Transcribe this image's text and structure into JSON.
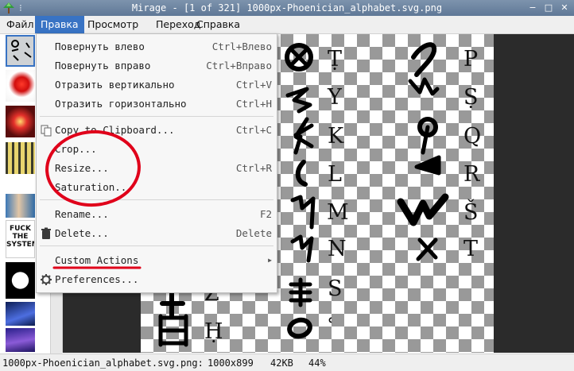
{
  "window": {
    "title": "Mirage - [1 of 321] 1000px-Phoenician_alphabet.svg.png"
  },
  "menubar": {
    "items": [
      {
        "label": "Файл"
      },
      {
        "label": "Правка"
      },
      {
        "label": "Просмотр"
      },
      {
        "label": "Переход"
      },
      {
        "label": "Справка"
      }
    ]
  },
  "edit_menu": {
    "items": [
      {
        "label": "Повернуть влево",
        "shortcut": "Ctrl+Влево"
      },
      {
        "label": "Повернуть вправо",
        "shortcut": "Ctrl+Вправо"
      },
      {
        "label": "Отразить вертикально",
        "shortcut": "Ctrl+V"
      },
      {
        "label": "Отразить горизонтально",
        "shortcut": "Ctrl+H"
      },
      {
        "label": "Copy to Clipboard...",
        "shortcut": "Ctrl+C"
      },
      {
        "label": "Crop...",
        "shortcut": ""
      },
      {
        "label": "Resize...",
        "shortcut": "Ctrl+R"
      },
      {
        "label": "Saturation...",
        "shortcut": ""
      },
      {
        "label": "Rename...",
        "shortcut": "F2"
      },
      {
        "label": "Delete...",
        "shortcut": "Delete"
      },
      {
        "label": "Custom Actions",
        "shortcut": ""
      },
      {
        "label": "Preferences...",
        "shortcut": ""
      }
    ]
  },
  "thumbnails": {
    "fuck_the_system_text": [
      "FUCK",
      "THE",
      "SYSTEM"
    ]
  },
  "canvas": {
    "letters_col1": [
      "Z",
      "Ḥ"
    ],
    "letters_col2": [
      "Ṭ",
      "Y",
      "K",
      "L",
      "M",
      "N",
      "S",
      "ʿ"
    ],
    "letters_col3": [
      "P",
      "Ṣ",
      "Q",
      "R",
      "Š",
      "T"
    ]
  },
  "statusbar": {
    "filename": "1000px-Phoenician_alphabet.svg.png:",
    "dimensions": "1000x899",
    "size": "42KB",
    "zoom": "44%"
  },
  "colors": {
    "menu_highlight": "#3873c4",
    "annotation_red": "#e0001a"
  }
}
